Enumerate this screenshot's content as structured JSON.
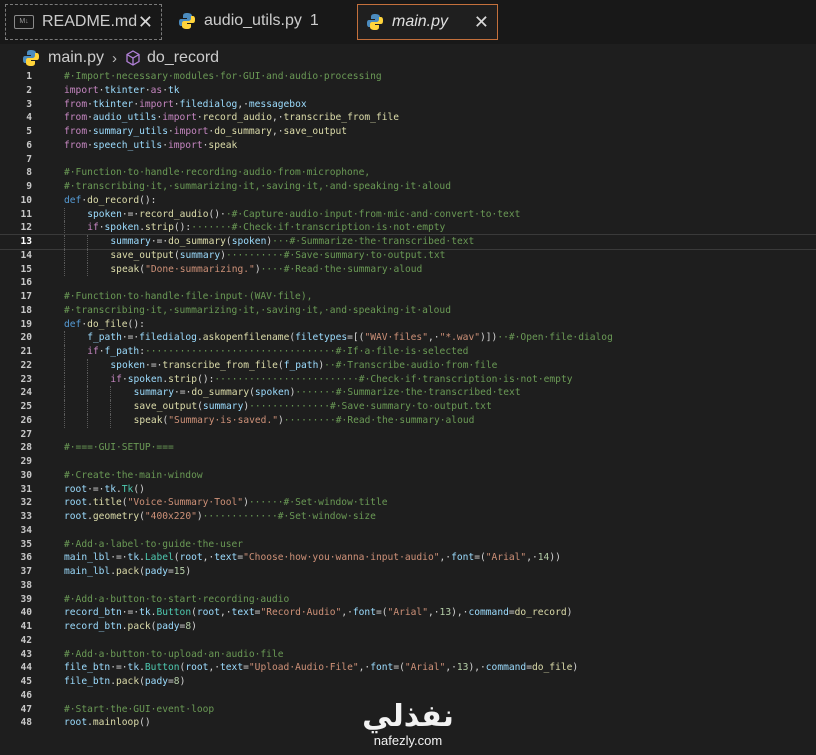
{
  "tabs": [
    {
      "label": "README.md",
      "icon": "markdown-icon"
    },
    {
      "label": "audio_utils.py",
      "icon": "python-icon",
      "problems": "1"
    },
    {
      "label": "main.py",
      "icon": "python-icon",
      "active": true
    }
  ],
  "markdown_icon_text": "M↓",
  "close_glyph": "✕",
  "breadcrumb": {
    "file": "main.py",
    "separator": "›",
    "symbol": "do_record"
  },
  "watermark": {
    "arabic": "نفذلي",
    "latin": "nafezly.com"
  },
  "current_line": 13,
  "lines": [
    {
      "n": "1",
      "indent": 0,
      "parts": [
        [
          "c-com",
          "#·Import·necessary·modules·for·GUI·and·audio·processing"
        ]
      ]
    },
    {
      "n": "2",
      "indent": 0,
      "parts": [
        [
          "c-kw",
          "import"
        ],
        [
          "",
          "·"
        ],
        [
          "c-var",
          "tkinter"
        ],
        [
          "",
          "·"
        ],
        [
          "c-kw",
          "as"
        ],
        [
          "",
          "·"
        ],
        [
          "c-var",
          "tk"
        ]
      ]
    },
    {
      "n": "3",
      "indent": 0,
      "parts": [
        [
          "c-kw",
          "from"
        ],
        [
          "",
          "·"
        ],
        [
          "c-var",
          "tkinter"
        ],
        [
          "",
          "·"
        ],
        [
          "c-kw",
          "import"
        ],
        [
          "",
          "·"
        ],
        [
          "c-var",
          "filedialog"
        ],
        [
          "",
          ",·"
        ],
        [
          "c-var",
          "messagebox"
        ]
      ]
    },
    {
      "n": "4",
      "indent": 0,
      "parts": [
        [
          "c-kw",
          "from"
        ],
        [
          "",
          "·"
        ],
        [
          "c-var",
          "audio_utils"
        ],
        [
          "",
          "·"
        ],
        [
          "c-kw",
          "import"
        ],
        [
          "",
          "·"
        ],
        [
          "c-fn",
          "record_audio"
        ],
        [
          "",
          ",·"
        ],
        [
          "c-fn",
          "transcribe_from_file"
        ]
      ]
    },
    {
      "n": "5",
      "indent": 0,
      "parts": [
        [
          "c-kw",
          "from"
        ],
        [
          "",
          "·"
        ],
        [
          "c-var",
          "summary_utils"
        ],
        [
          "",
          "·"
        ],
        [
          "c-kw",
          "import"
        ],
        [
          "",
          "·"
        ],
        [
          "c-fn",
          "do_summary"
        ],
        [
          "",
          ",·"
        ],
        [
          "c-fn",
          "save_output"
        ]
      ]
    },
    {
      "n": "6",
      "indent": 0,
      "parts": [
        [
          "c-kw",
          "from"
        ],
        [
          "",
          "·"
        ],
        [
          "c-var",
          "speech_utils"
        ],
        [
          "",
          "·"
        ],
        [
          "c-kw",
          "import"
        ],
        [
          "",
          "·"
        ],
        [
          "c-fn",
          "speak"
        ]
      ]
    },
    {
      "n": "7",
      "indent": 0,
      "parts": []
    },
    {
      "n": "8",
      "indent": 0,
      "parts": [
        [
          "c-com",
          "#·Function·to·handle·recording·audio·from·microphone,"
        ]
      ]
    },
    {
      "n": "9",
      "indent": 0,
      "parts": [
        [
          "c-com",
          "#·transcribing·it,·summarizing·it,·saving·it,·and·speaking·it·aloud"
        ]
      ]
    },
    {
      "n": "10",
      "indent": 0,
      "parts": [
        [
          "c-def",
          "def"
        ],
        [
          "",
          "·"
        ],
        [
          "c-fn",
          "do_record"
        ],
        [
          "",
          "():"
        ]
      ]
    },
    {
      "n": "11",
      "indent": 1,
      "parts": [
        [
          "c-var",
          "spoken"
        ],
        [
          "",
          "·=·"
        ],
        [
          "c-fn",
          "record_audio"
        ],
        [
          "",
          "()·"
        ],
        [
          "c-com",
          "·#·Capture·audio·input·from·mic·and·convert·to·text"
        ]
      ]
    },
    {
      "n": "12",
      "indent": 1,
      "parts": [
        [
          "c-kw",
          "if"
        ],
        [
          "",
          "·"
        ],
        [
          "c-var",
          "spoken"
        ],
        [
          "",
          "."
        ],
        [
          "c-fn",
          "strip"
        ],
        [
          "",
          "():"
        ],
        [
          "c-com",
          "·······#·Check·if·transcription·is·not·empty"
        ]
      ]
    },
    {
      "n": "13",
      "indent": 2,
      "parts": [
        [
          "c-var",
          "summary"
        ],
        [
          "",
          "·=·"
        ],
        [
          "c-fn",
          "do_summary"
        ],
        [
          "",
          "("
        ],
        [
          "c-var",
          "spoken"
        ],
        [
          "",
          ")"
        ],
        [
          "c-com",
          "···#·Summarize·the·transcribed·text"
        ]
      ]
    },
    {
      "n": "14",
      "indent": 2,
      "parts": [
        [
          "c-fn",
          "save_output"
        ],
        [
          "",
          "("
        ],
        [
          "c-var",
          "summary"
        ],
        [
          "",
          ")"
        ],
        [
          "c-com",
          "··········#·Save·summary·to·output.txt"
        ]
      ]
    },
    {
      "n": "15",
      "indent": 2,
      "parts": [
        [
          "c-fn",
          "speak"
        ],
        [
          "",
          "("
        ],
        [
          "c-str",
          "\"Done·summarizing.\""
        ],
        [
          "",
          ")"
        ],
        [
          "c-com",
          "····#·Read·the·summary·aloud"
        ]
      ]
    },
    {
      "n": "16",
      "indent": 0,
      "parts": []
    },
    {
      "n": "17",
      "indent": 0,
      "parts": [
        [
          "c-com",
          "#·Function·to·handle·file·input·(WAV·file),"
        ]
      ]
    },
    {
      "n": "18",
      "indent": 0,
      "parts": [
        [
          "c-com",
          "#·transcribing·it,·summarizing·it,·saving·it,·and·speaking·it·aloud"
        ]
      ]
    },
    {
      "n": "19",
      "indent": 0,
      "parts": [
        [
          "c-def",
          "def"
        ],
        [
          "",
          "·"
        ],
        [
          "c-fn",
          "do_file"
        ],
        [
          "",
          "():"
        ]
      ]
    },
    {
      "n": "20",
      "indent": 1,
      "parts": [
        [
          "c-var",
          "f_path"
        ],
        [
          "",
          "·=·"
        ],
        [
          "c-var",
          "filedialog"
        ],
        [
          "",
          "."
        ],
        [
          "c-fn",
          "askopenfilename"
        ],
        [
          "",
          "("
        ],
        [
          "c-var",
          "filetypes"
        ],
        [
          "",
          "=[("
        ],
        [
          "c-str",
          "\"WAV·files\""
        ],
        [
          "",
          ",·"
        ],
        [
          "c-str",
          "\"*.wav\""
        ],
        [
          "",
          ")])"
        ],
        [
          "c-com",
          "··#·Open·file·dialog"
        ]
      ]
    },
    {
      "n": "21",
      "indent": 1,
      "parts": [
        [
          "c-kw",
          "if"
        ],
        [
          "",
          "·"
        ],
        [
          "c-var",
          "f_path"
        ],
        [
          "",
          ":"
        ],
        [
          "c-com",
          "·································#·If·a·file·is·selected"
        ]
      ]
    },
    {
      "n": "22",
      "indent": 2,
      "parts": [
        [
          "c-var",
          "spoken"
        ],
        [
          "",
          "·=·"
        ],
        [
          "c-fn",
          "transcribe_from_file"
        ],
        [
          "",
          "("
        ],
        [
          "c-var",
          "f_path"
        ],
        [
          "",
          ")"
        ],
        [
          "c-com",
          "··#·Transcribe·audio·from·file"
        ]
      ]
    },
    {
      "n": "23",
      "indent": 2,
      "parts": [
        [
          "c-kw",
          "if"
        ],
        [
          "",
          "·"
        ],
        [
          "c-var",
          "spoken"
        ],
        [
          "",
          "."
        ],
        [
          "c-fn",
          "strip"
        ],
        [
          "",
          "():"
        ],
        [
          "c-com",
          "·························#·Check·if·transcription·is·not·empty"
        ]
      ]
    },
    {
      "n": "24",
      "indent": 3,
      "parts": [
        [
          "c-var",
          "summary"
        ],
        [
          "",
          "·=·"
        ],
        [
          "c-fn",
          "do_summary"
        ],
        [
          "",
          "("
        ],
        [
          "c-var",
          "spoken"
        ],
        [
          "",
          ")"
        ],
        [
          "c-com",
          "·······#·Summarize·the·transcribed·text"
        ]
      ]
    },
    {
      "n": "25",
      "indent": 3,
      "parts": [
        [
          "c-fn",
          "save_output"
        ],
        [
          "",
          "("
        ],
        [
          "c-var",
          "summary"
        ],
        [
          "",
          ")"
        ],
        [
          "c-com",
          "··············#·Save·summary·to·output.txt"
        ]
      ]
    },
    {
      "n": "26",
      "indent": 3,
      "parts": [
        [
          "c-fn",
          "speak"
        ],
        [
          "",
          "("
        ],
        [
          "c-str",
          "\"Summary·is·saved.\""
        ],
        [
          "",
          ")"
        ],
        [
          "c-com",
          "·········#·Read·the·summary·aloud"
        ]
      ]
    },
    {
      "n": "27",
      "indent": 0,
      "parts": []
    },
    {
      "n": "28",
      "indent": 0,
      "parts": [
        [
          "c-com",
          "#·===·GUI·SETUP·==="
        ]
      ]
    },
    {
      "n": "29",
      "indent": 0,
      "parts": []
    },
    {
      "n": "30",
      "indent": 0,
      "parts": [
        [
          "c-com",
          "#·Create·the·main·window"
        ]
      ]
    },
    {
      "n": "31",
      "indent": 0,
      "parts": [
        [
          "c-var",
          "root"
        ],
        [
          "",
          "·=·"
        ],
        [
          "c-var",
          "tk"
        ],
        [
          "",
          "."
        ],
        [
          "c-cls",
          "Tk"
        ],
        [
          "",
          "()"
        ]
      ]
    },
    {
      "n": "32",
      "indent": 0,
      "parts": [
        [
          "c-var",
          "root"
        ],
        [
          "",
          "."
        ],
        [
          "c-fn",
          "title"
        ],
        [
          "",
          "("
        ],
        [
          "c-str",
          "\"Voice·Summary·Tool\""
        ],
        [
          "",
          ")"
        ],
        [
          "c-com",
          "······#·Set·window·title"
        ]
      ]
    },
    {
      "n": "33",
      "indent": 0,
      "parts": [
        [
          "c-var",
          "root"
        ],
        [
          "",
          "."
        ],
        [
          "c-fn",
          "geometry"
        ],
        [
          "",
          "("
        ],
        [
          "c-str",
          "\"400x220\""
        ],
        [
          "",
          ")"
        ],
        [
          "c-com",
          "·············#·Set·window·size"
        ]
      ]
    },
    {
      "n": "34",
      "indent": 0,
      "parts": []
    },
    {
      "n": "35",
      "indent": 0,
      "parts": [
        [
          "c-com",
          "#·Add·a·label·to·guide·the·user"
        ]
      ]
    },
    {
      "n": "36",
      "indent": 0,
      "parts": [
        [
          "c-var",
          "main_lbl"
        ],
        [
          "",
          "·=·"
        ],
        [
          "c-var",
          "tk"
        ],
        [
          "",
          "."
        ],
        [
          "c-cls",
          "Label"
        ],
        [
          "",
          "("
        ],
        [
          "c-var",
          "root"
        ],
        [
          "",
          ",·"
        ],
        [
          "c-var",
          "text"
        ],
        [
          "",
          "="
        ],
        [
          "c-str",
          "\"Choose·how·you·wanna·input·audio\""
        ],
        [
          "",
          ",·"
        ],
        [
          "c-var",
          "font"
        ],
        [
          "",
          "=("
        ],
        [
          "c-str",
          "\"Arial\""
        ],
        [
          "",
          ",·"
        ],
        [
          "c-num",
          "14"
        ],
        [
          "",
          "))"
        ]
      ]
    },
    {
      "n": "37",
      "indent": 0,
      "parts": [
        [
          "c-var",
          "main_lbl"
        ],
        [
          "",
          "."
        ],
        [
          "c-fn",
          "pack"
        ],
        [
          "",
          "("
        ],
        [
          "c-var",
          "pady"
        ],
        [
          "",
          "="
        ],
        [
          "c-num",
          "15"
        ],
        [
          "",
          ")"
        ]
      ]
    },
    {
      "n": "38",
      "indent": 0,
      "parts": []
    },
    {
      "n": "39",
      "indent": 0,
      "parts": [
        [
          "c-com",
          "#·Add·a·button·to·start·recording·audio"
        ]
      ]
    },
    {
      "n": "40",
      "indent": 0,
      "parts": [
        [
          "c-var",
          "record_btn"
        ],
        [
          "",
          "·=·"
        ],
        [
          "c-var",
          "tk"
        ],
        [
          "",
          "."
        ],
        [
          "c-cls",
          "Button"
        ],
        [
          "",
          "("
        ],
        [
          "c-var",
          "root"
        ],
        [
          "",
          ",·"
        ],
        [
          "c-var",
          "text"
        ],
        [
          "",
          "="
        ],
        [
          "c-str",
          "\"Record·Audio\""
        ],
        [
          "",
          ",·"
        ],
        [
          "c-var",
          "font"
        ],
        [
          "",
          "=("
        ],
        [
          "c-str",
          "\"Arial\""
        ],
        [
          "",
          ",·"
        ],
        [
          "c-num",
          "13"
        ],
        [
          "",
          "),·"
        ],
        [
          "c-var",
          "command"
        ],
        [
          "",
          "="
        ],
        [
          "c-fn",
          "do_record"
        ],
        [
          "",
          ")"
        ]
      ]
    },
    {
      "n": "41",
      "indent": 0,
      "parts": [
        [
          "c-var",
          "record_btn"
        ],
        [
          "",
          "."
        ],
        [
          "c-fn",
          "pack"
        ],
        [
          "",
          "("
        ],
        [
          "c-var",
          "pady"
        ],
        [
          "",
          "="
        ],
        [
          "c-num",
          "8"
        ],
        [
          "",
          ")"
        ]
      ]
    },
    {
      "n": "42",
      "indent": 0,
      "parts": []
    },
    {
      "n": "43",
      "indent": 0,
      "parts": [
        [
          "c-com",
          "#·Add·a·button·to·upload·an·audio·file"
        ]
      ]
    },
    {
      "n": "44",
      "indent": 0,
      "parts": [
        [
          "c-var",
          "file_btn"
        ],
        [
          "",
          "·=·"
        ],
        [
          "c-var",
          "tk"
        ],
        [
          "",
          "."
        ],
        [
          "c-cls",
          "Button"
        ],
        [
          "",
          "("
        ],
        [
          "c-var",
          "root"
        ],
        [
          "",
          ",·"
        ],
        [
          "c-var",
          "text"
        ],
        [
          "",
          "="
        ],
        [
          "c-str",
          "\"Upload·Audio·File\""
        ],
        [
          "",
          ",·"
        ],
        [
          "c-var",
          "font"
        ],
        [
          "",
          "=("
        ],
        [
          "c-str",
          "\"Arial\""
        ],
        [
          "",
          ",·"
        ],
        [
          "c-num",
          "13"
        ],
        [
          "",
          "),·"
        ],
        [
          "c-var",
          "command"
        ],
        [
          "",
          "="
        ],
        [
          "c-fn",
          "do_file"
        ],
        [
          "",
          ")"
        ]
      ]
    },
    {
      "n": "45",
      "indent": 0,
      "parts": [
        [
          "c-var",
          "file_btn"
        ],
        [
          "",
          "."
        ],
        [
          "c-fn",
          "pack"
        ],
        [
          "",
          "("
        ],
        [
          "c-var",
          "pady"
        ],
        [
          "",
          "="
        ],
        [
          "c-num",
          "8"
        ],
        [
          "",
          ")"
        ]
      ]
    },
    {
      "n": "46",
      "indent": 0,
      "parts": []
    },
    {
      "n": "47",
      "indent": 0,
      "parts": [
        [
          "c-com",
          "#·Start·the·GUI·event·loop"
        ]
      ]
    },
    {
      "n": "48",
      "indent": 0,
      "parts": [
        [
          "c-var",
          "root"
        ],
        [
          "",
          "."
        ],
        [
          "c-fn",
          "mainloop"
        ],
        [
          "",
          "()"
        ]
      ]
    }
  ]
}
